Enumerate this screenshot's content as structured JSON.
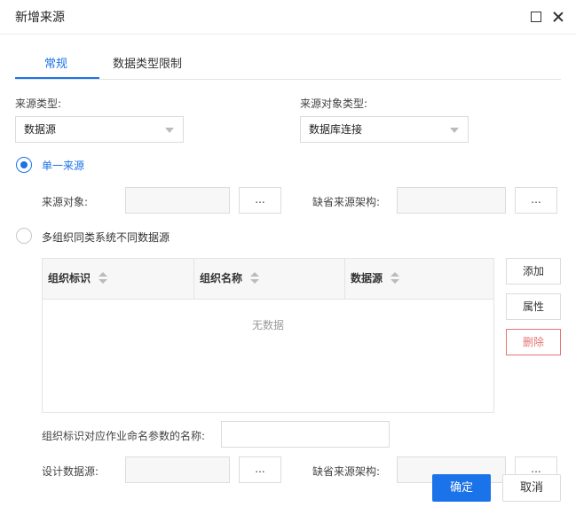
{
  "dialog": {
    "title": "新增来源"
  },
  "tabs": [
    {
      "label": "常规",
      "active": true
    },
    {
      "label": "数据类型限制",
      "active": false
    }
  ],
  "source_type": {
    "label": "来源类型:",
    "value": "数据源"
  },
  "source_object_type": {
    "label": "来源对象类型:",
    "value": "数据库连接"
  },
  "single_source": {
    "radio_label": "单一来源",
    "selected": true,
    "object_label": "来源对象:",
    "object_value": "",
    "browse_label": "...",
    "default_schema_label": "缺省来源架构:",
    "default_schema_value": "",
    "schema_browse_label": "..."
  },
  "multi_org": {
    "radio_label": "多组织同类系统不同数据源",
    "selected": false,
    "table": {
      "columns": [
        "组织标识",
        "组织名称",
        "数据源"
      ],
      "empty_text": "无数据",
      "rows": []
    },
    "buttons": {
      "add": "添加",
      "properties": "属性",
      "delete": "删除"
    },
    "param_name_label": "组织标识对应作业命名参数的名称:",
    "param_name_value": "",
    "design_ds_label": "设计数据源:",
    "design_ds_browse": "...",
    "default_schema_label": "缺省来源架构:",
    "default_schema_browse": "..."
  },
  "footer": {
    "ok": "确定",
    "cancel": "取消"
  },
  "colors": {
    "accent": "#1a73e8",
    "danger": "#e57373"
  }
}
